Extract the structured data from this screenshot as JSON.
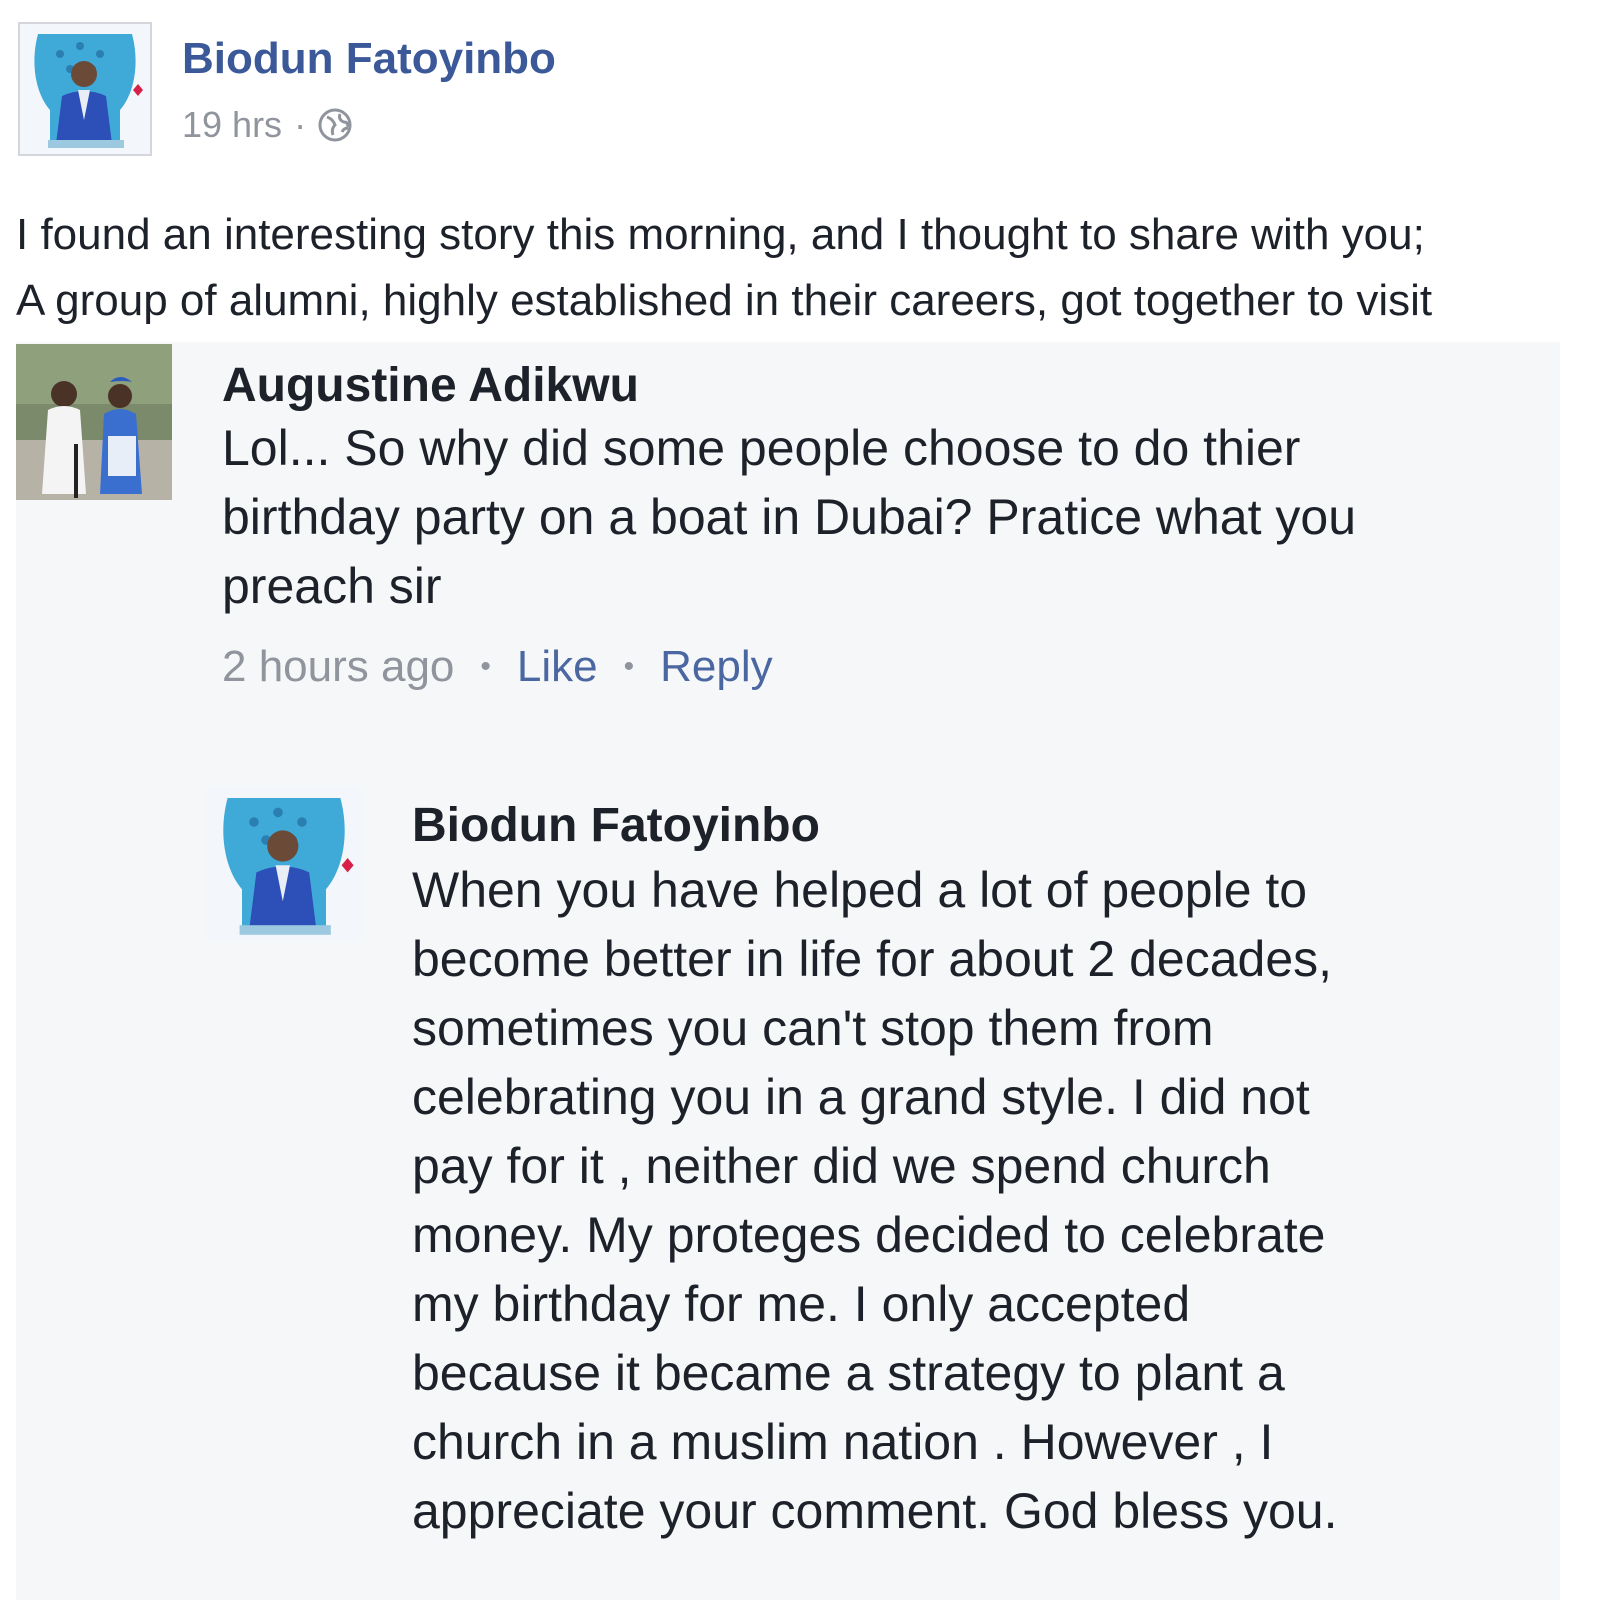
{
  "post": {
    "author": "Biodun Fatoyinbo",
    "time": "19 hrs",
    "separator": "·",
    "privacy_icon": "globe-icon",
    "body_lines": [
      "I found an interesting story this morning, and I thought to share with you;",
      "A group of alumni, highly established in their careers, got together to visit"
    ]
  },
  "comments": [
    {
      "author": "Augustine Adikwu",
      "text_lines": [
        "Lol... So why did some people choose to do thier",
        "birthday party on a boat in Dubai? Pratice what you",
        "preach sir"
      ],
      "time": "2 hours ago",
      "like_label": "Like",
      "reply_label": "Reply",
      "separator": "•"
    },
    {
      "author": "Biodun Fatoyinbo",
      "text_lines": [
        "When you have helped a lot of people to",
        "become better in life for about 2 decades,",
        "sometimes you can't stop them from",
        "celebrating you in a grand style.  I did not",
        "pay for it ,  neither did we spend church",
        "money. My proteges decided to celebrate",
        "my birthday for  me.  I only accepted",
        "because it became a strategy to plant a",
        "church in a muslim nation  .  However ,  I",
        "appreciate your comment.  God bless you."
      ]
    }
  ],
  "colors": {
    "link_blue": "#3b5998",
    "action_blue": "#4b67a1",
    "meta_gray": "#90949c",
    "text": "#1d2129",
    "comment_bg": "#f6f7f9"
  }
}
